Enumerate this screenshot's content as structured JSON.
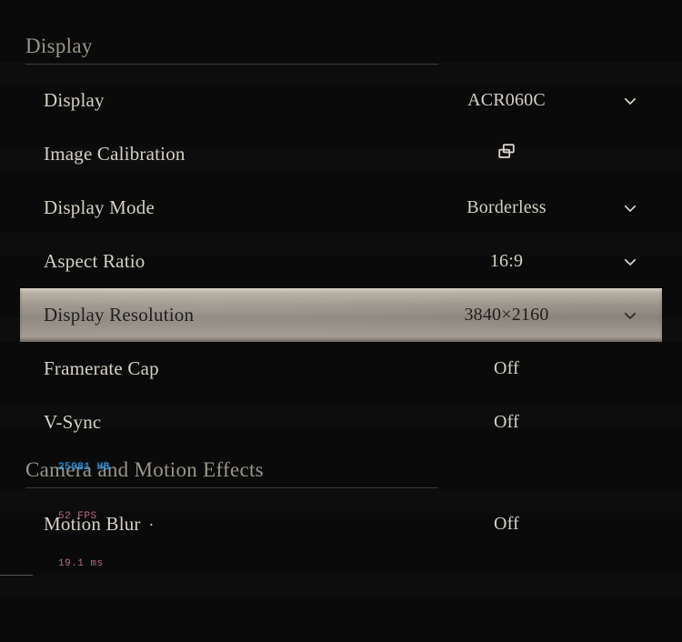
{
  "sections": {
    "display": {
      "header": "Display"
    },
    "camera": {
      "header": "Camera and Motion Effects"
    }
  },
  "rows": {
    "display": {
      "label": "Display",
      "value": "ACR060C"
    },
    "image_calibration": {
      "label": "Image Calibration"
    },
    "display_mode": {
      "label": "Display Mode",
      "value": "Borderless"
    },
    "aspect_ratio": {
      "label": "Aspect Ratio",
      "value": "16:9"
    },
    "resolution": {
      "label": "Display Resolution",
      "value": "3840×2160"
    },
    "framerate_cap": {
      "label": "Framerate Cap",
      "value": "Off"
    },
    "vsync": {
      "label": "V-Sync",
      "value": "Off"
    },
    "motion_blur": {
      "label": "Motion Blur",
      "value": "Off"
    }
  },
  "hud": {
    "mem": "25981 HB",
    "fps": "52 FPS",
    "ms": "19.1 ms"
  }
}
